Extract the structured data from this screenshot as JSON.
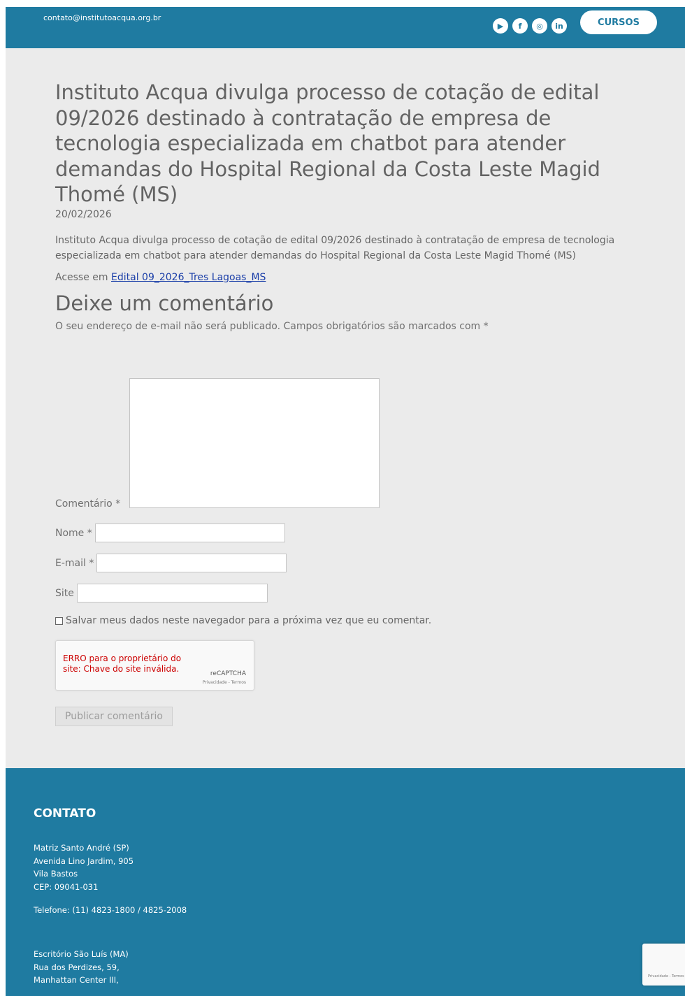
{
  "topbar": {
    "email": "contato@institutoacqua.org.br",
    "social": [
      {
        "icon": "youtube-icon",
        "glyph": "▶"
      },
      {
        "icon": "facebook-icon",
        "glyph": "f"
      },
      {
        "icon": "instagram-icon",
        "glyph": "◎"
      },
      {
        "icon": "linkedin-icon",
        "glyph": "in"
      }
    ],
    "cursos_label": "CURSOS"
  },
  "post": {
    "title": "Instituto Acqua divulga processo de cotação de edital 09/2026 destinado à contratação de empresa de tecnologia especializada em chatbot para atender demandas do Hospital Regional da Costa Leste Magid Thomé (MS)",
    "date": "20/02/2026",
    "excerpt": "Instituto Acqua divulga processo de cotação de edital 09/2026 destinado à contratação de empresa de tecnologia especializada em chatbot para atender demandas do Hospital Regional da Costa Leste Magid Thomé (MS)",
    "access_prefix": "Acesse em",
    "access_link": "Edital 09_2026_Tres Lagoas_MS"
  },
  "comments": {
    "heading": "Deixe um comentário",
    "notice": "O seu endereço de e-mail não será publicado. Campos obrigatórios são marcados com *",
    "comment_label": "Comentário *",
    "name_label": "Nome *",
    "email_label": "E-mail *",
    "site_label": "Site",
    "save_label": "Salvar meus dados neste navegador para a próxima vez que eu comentar.",
    "recaptcha_error": "ERRO para o proprietário do site: Chave do site inválida.",
    "recaptcha_brand": "reCAPTCHA",
    "recaptcha_terms": "Privacidade - Termos",
    "submit_label": "Publicar comentário"
  },
  "footer": {
    "heading": "CONTATO",
    "hq": [
      "Matriz Santo André (SP)",
      "Avenida Lino Jardim, 905",
      "Vila Bastos",
      "CEP: 09041-031"
    ],
    "phone": "Telefone: (11) 4823-1800 / 4825-2008",
    "office": [
      "Escritório São Luís (MA)",
      "Rua dos Perdizes, 59,",
      "Manhattan Center III,"
    ]
  },
  "mini_captcha_text": "Privacidade - Termos",
  "colors": {
    "brand": "#1f7ba1",
    "background": "#ebebeb",
    "link": "#1a3ea8",
    "error": "#cc0000"
  }
}
